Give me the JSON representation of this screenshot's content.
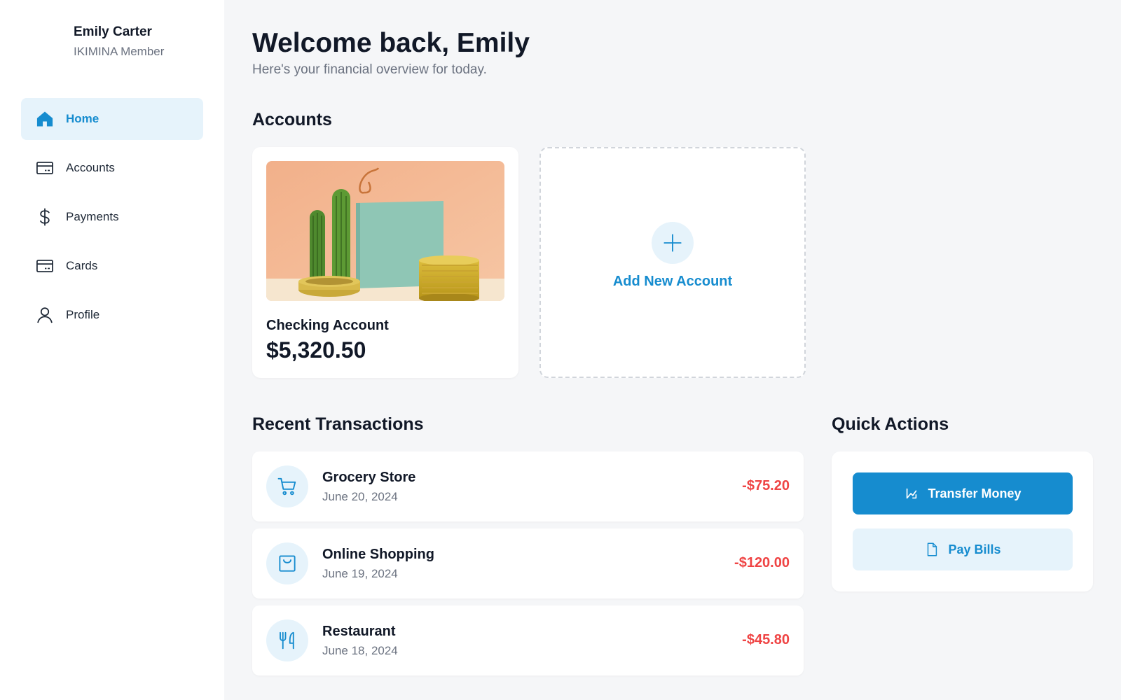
{
  "profile": {
    "name": "Emily Carter",
    "role": "IKIMINA Member"
  },
  "nav": {
    "items": [
      {
        "label": "Home",
        "icon": "home-icon",
        "active": true
      },
      {
        "label": "Accounts",
        "icon": "credit-card-icon",
        "active": false
      },
      {
        "label": "Payments",
        "icon": "dollar-icon",
        "active": false
      },
      {
        "label": "Cards",
        "icon": "credit-card-icon",
        "active": false
      },
      {
        "label": "Profile",
        "icon": "user-icon",
        "active": false
      }
    ]
  },
  "header": {
    "welcome": "Welcome back, Emily",
    "subtitle": "Here's your financial overview for today."
  },
  "accounts": {
    "title": "Accounts",
    "cards": [
      {
        "name": "Checking Account",
        "balance": "$5,320.50"
      }
    ],
    "add_label": "Add New Account"
  },
  "transactions": {
    "title": "Recent Transactions",
    "items": [
      {
        "name": "Grocery Store",
        "date": "June 20, 2024",
        "amount": "-$75.20",
        "icon": "shopping-cart-icon"
      },
      {
        "name": "Online Shopping",
        "date": "June 19, 2024",
        "amount": "-$120.00",
        "icon": "shopping-bag-icon"
      },
      {
        "name": "Restaurant",
        "date": "June 18, 2024",
        "amount": "-$45.80",
        "icon": "utensils-icon"
      }
    ]
  },
  "quick_actions": {
    "title": "Quick Actions",
    "transfer_label": "Transfer Money",
    "pay_bills_label": "Pay Bills"
  },
  "colors": {
    "accent": "#168ccf",
    "accent_light": "#e6f3fb",
    "negative": "#ef4444",
    "background": "#f5f6f8"
  }
}
